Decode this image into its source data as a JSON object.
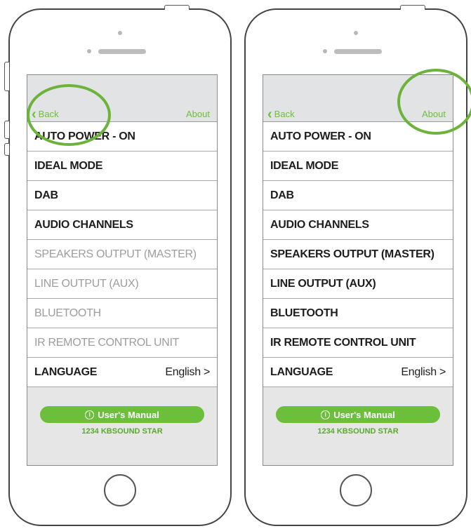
{
  "phones": [
    {
      "nav": {
        "back_label": "Back",
        "about_label": "About"
      },
      "settings": [
        {
          "label": "AUTO POWER - ON",
          "value": "",
          "enabled": true
        },
        {
          "label": "IDEAL MODE",
          "value": "",
          "enabled": true
        },
        {
          "label": "DAB",
          "value": "",
          "enabled": true
        },
        {
          "label": "AUDIO CHANNELS",
          "value": "",
          "enabled": true
        },
        {
          "label": "SPEAKERS OUTPUT (MASTER)",
          "value": "",
          "enabled": false
        },
        {
          "label": "LINE OUTPUT (AUX)",
          "value": "",
          "enabled": false
        },
        {
          "label": "BLUETOOTH",
          "value": "",
          "enabled": false
        },
        {
          "label": "IR REMOTE CONTROL UNIT",
          "value": "",
          "enabled": false
        },
        {
          "label": "LANGUAGE",
          "value": "English >",
          "enabled": true
        }
      ],
      "manual_button_label": "User's Manual",
      "device_name": "1234 KBSOUND STAR",
      "highlighted_control": "back-button"
    },
    {
      "nav": {
        "back_label": "Back",
        "about_label": "About"
      },
      "settings": [
        {
          "label": "AUTO POWER - ON",
          "value": "",
          "enabled": true
        },
        {
          "label": "IDEAL MODE",
          "value": "",
          "enabled": true
        },
        {
          "label": "DAB",
          "value": "",
          "enabled": true
        },
        {
          "label": "AUDIO CHANNELS",
          "value": "",
          "enabled": true
        },
        {
          "label": "SPEAKERS OUTPUT (MASTER)",
          "value": "",
          "enabled": true
        },
        {
          "label": "LINE OUTPUT (AUX)",
          "value": "",
          "enabled": true
        },
        {
          "label": "BLUETOOTH",
          "value": "",
          "enabled": true
        },
        {
          "label": "IR REMOTE CONTROL UNIT",
          "value": "",
          "enabled": true
        },
        {
          "label": "LANGUAGE",
          "value": "English >",
          "enabled": true
        }
      ],
      "manual_button_label": "User's Manual",
      "device_name": "1234 KBSOUND STAR",
      "highlighted_control": "about-link"
    }
  ],
  "colors": {
    "accent": "#6cbf3b",
    "highlight": "#6cb33c",
    "disabled_text": "#9d9d9d",
    "screen_bg": "#e6e6e6"
  },
  "icons": {
    "back": "chevron-left-icon",
    "info": "info-icon"
  }
}
